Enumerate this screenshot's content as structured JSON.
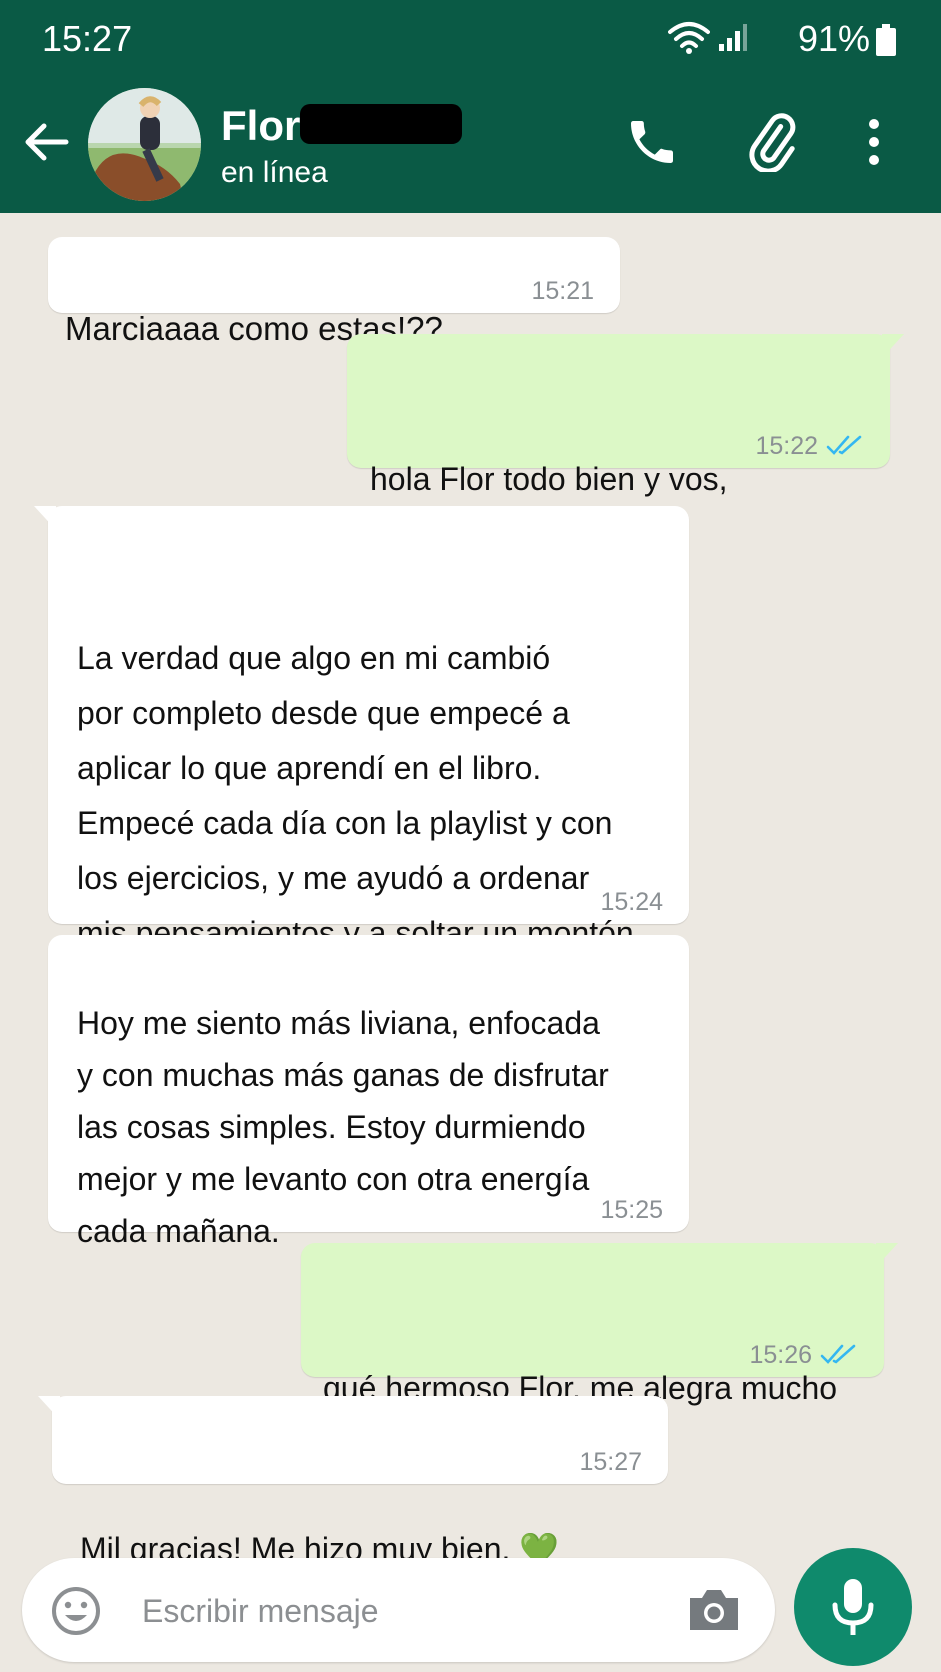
{
  "status_bar": {
    "time": "15:27",
    "battery": "91%"
  },
  "header": {
    "contact_name": "Flor",
    "contact_status": "en línea"
  },
  "messages": [
    {
      "direction": "in",
      "text": "Marciaaaa como estas!??",
      "time": "15:21"
    },
    {
      "direction": "out",
      "text": "hola Flor todo bien y vos,\nque contas?",
      "time": "15:22",
      "read": true
    },
    {
      "direction": "in",
      "text": "La verdad que algo en mi cambió\npor completo desde que empecé a\naplicar lo que aprendí en el libro.\nEmpecé cada día con la playlist y con\nlos ejercicios, y me ayudó a ordenar\nmis pensamientos y a soltar un montón\nde cosas que me pesaban.",
      "time": "15:24"
    },
    {
      "direction": "in",
      "text": "Hoy me siento más liviana, enfocada\ny con muchas más ganas de disfrutar\nlas cosas simples. Estoy durmiendo\nmejor y me levanto con otra energía\ncada mañana.",
      "time": "15:25"
    },
    {
      "direction": "out",
      "text": "qué hermoso Flor, me alegra mucho\nleer eso! seguí así ✨",
      "time": "15:26",
      "read": true
    },
    {
      "direction": "in",
      "text": "Mil gracias! Me hizo muy bien. 💚",
      "time": "15:27"
    }
  ],
  "composer": {
    "placeholder": "Escribir mensaje"
  },
  "colors": {
    "header_bg": "#0a5a45",
    "chat_bg": "#ece8e1",
    "incoming_bubble": "#ffffff",
    "outgoing_bubble": "#dcf8c6",
    "read_ticks": "#34b7f1",
    "mic_button": "#0f8a6c"
  }
}
